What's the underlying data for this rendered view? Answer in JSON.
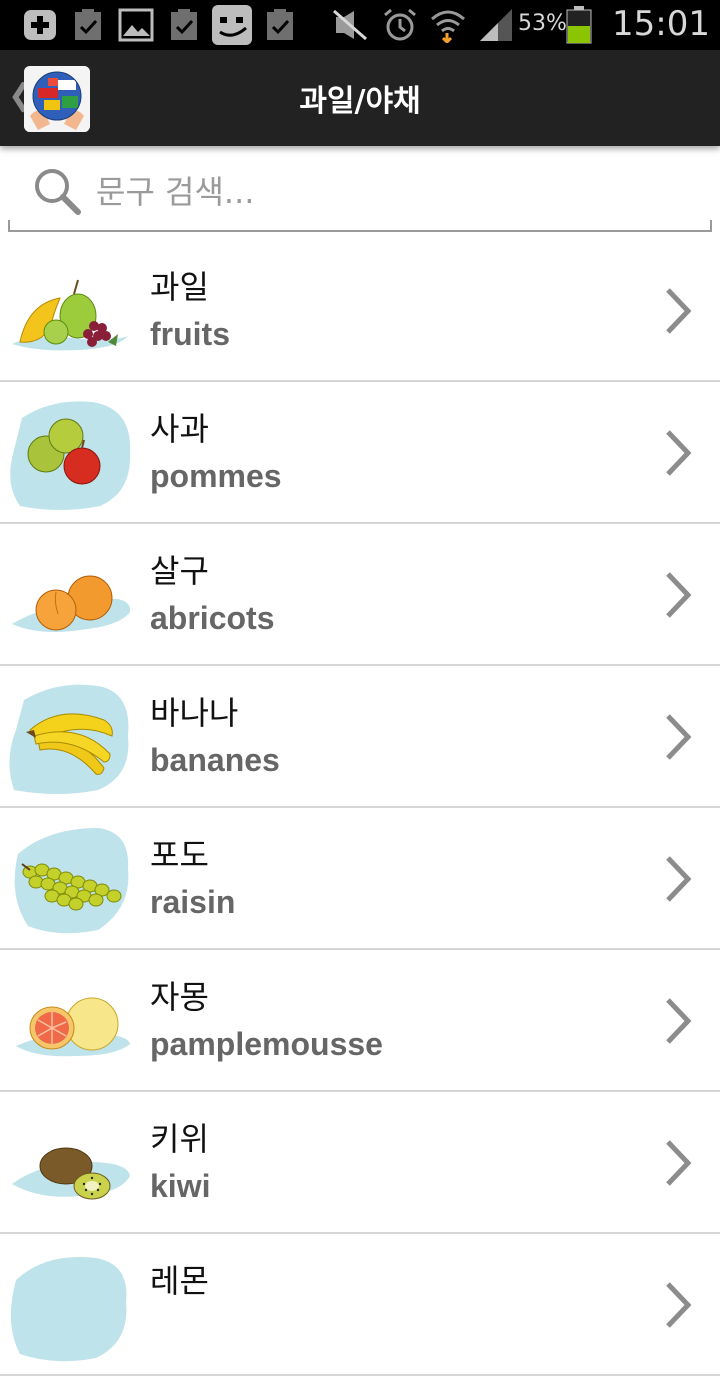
{
  "status_bar": {
    "icons": [
      "add-box-icon",
      "clipboard-check-icon",
      "image-icon",
      "clipboard-check-icon",
      "app-face-icon",
      "clipboard-check-icon",
      "mute-icon",
      "alarm-icon",
      "wifi-icon",
      "signal-icon",
      "battery-icon"
    ],
    "battery_percent": "53%",
    "battery_level": 0.53,
    "battery_color": "#8bc400",
    "time": "15:01"
  },
  "action_bar": {
    "up_glyph": "❮",
    "title": "과일/야채",
    "background": "#222222"
  },
  "search": {
    "placeholder": "문구 검색..."
  },
  "items": [
    {
      "ko": "과일",
      "fr": "fruits",
      "image": "fruit-mix-icon"
    },
    {
      "ko": "사과",
      "fr": "pommes",
      "image": "apples-icon"
    },
    {
      "ko": "살구",
      "fr": "abricots",
      "image": "apricots-icon"
    },
    {
      "ko": "바나나",
      "fr": "bananes",
      "image": "bananas-icon"
    },
    {
      "ko": "포도",
      "fr": "raisin",
      "image": "grapes-icon"
    },
    {
      "ko": "자몽",
      "fr": "pamplemousse",
      "image": "grapefruit-icon"
    },
    {
      "ko": "키위",
      "fr": "kiwi",
      "image": "kiwi-icon"
    },
    {
      "ko": "레몬",
      "fr": "",
      "image": "lemon-icon"
    }
  ],
  "colors": {
    "chevron": "#8c8c8c",
    "thumb_bg": "#bfe3ea",
    "divider": "#d6d6d6"
  }
}
